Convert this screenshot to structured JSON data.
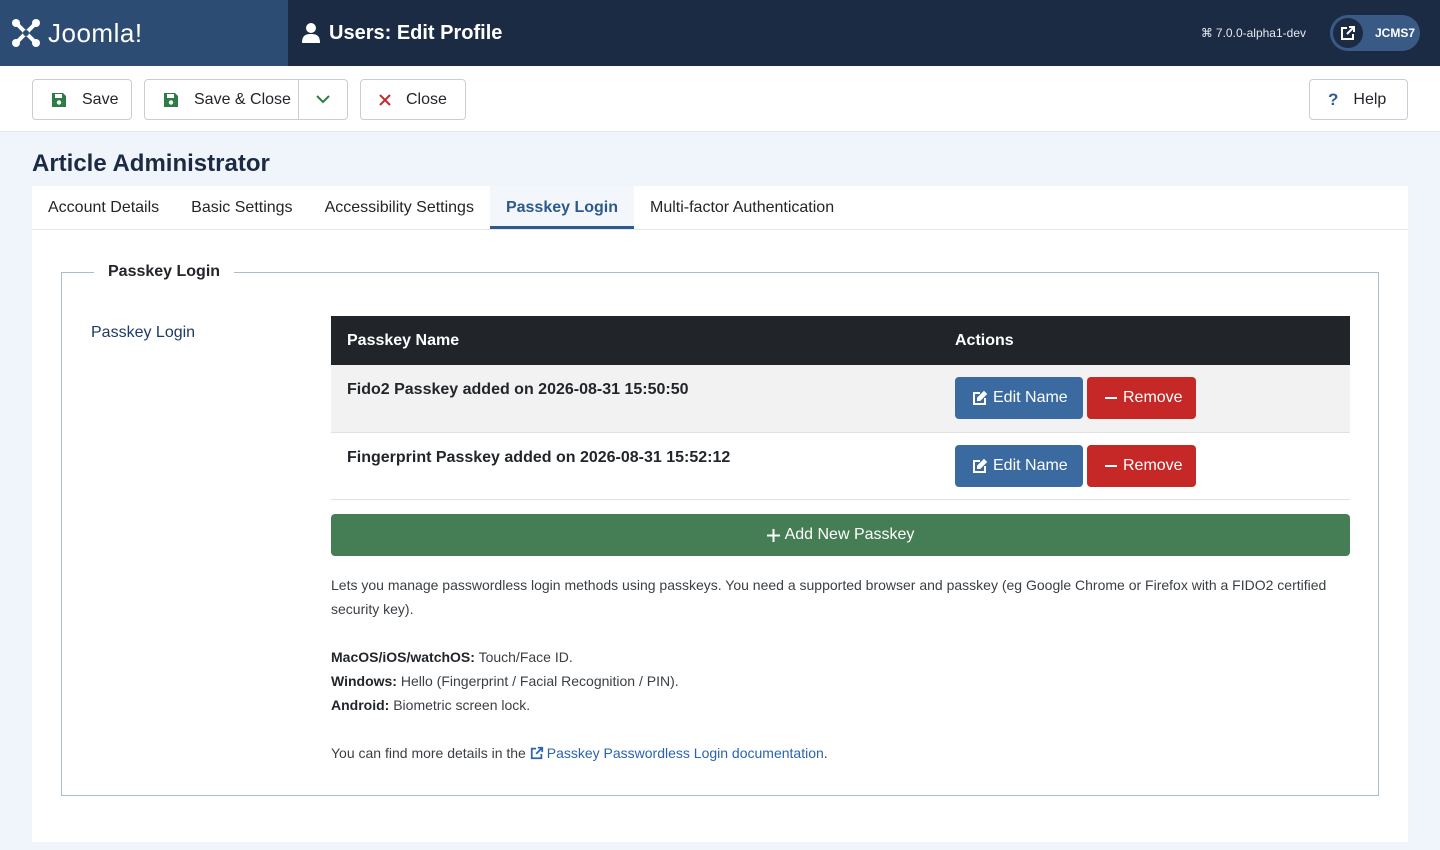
{
  "header": {
    "logo_text": "Joomla!",
    "title": "Users: Edit Profile",
    "version": "7.0.0-alpha1-dev",
    "site_button": "JCMS7"
  },
  "toolbar": {
    "save": "Save",
    "save_close": "Save & Close",
    "close": "Close",
    "help": "Help"
  },
  "section_title": "Article Administrator",
  "tabs": [
    {
      "label": "Account Details"
    },
    {
      "label": "Basic Settings"
    },
    {
      "label": "Accessibility Settings"
    },
    {
      "label": "Passkey Login"
    },
    {
      "label": "Multi-factor Authentication"
    }
  ],
  "passkey": {
    "legend": "Passkey Login",
    "side_label": "Passkey Login",
    "table": {
      "col_name": "Passkey Name",
      "col_actions": "Actions",
      "rows": [
        {
          "name": "Fido2 Passkey added on 2026-08-31 15:50:50",
          "edit": "Edit Name",
          "remove": "Remove"
        },
        {
          "name": "Fingerprint Passkey added on 2026-08-31 15:52:12",
          "edit": "Edit Name",
          "remove": "Remove"
        }
      ]
    },
    "add_button": "Add New Passkey",
    "description": "Lets you manage passwordless login methods using passkeys. You need a supported browser and passkey (eg Google Chrome or Firefox with a FIDO2 certified security key).",
    "platforms": [
      {
        "name": "MacOS/iOS/watchOS:",
        "value": "Touch/Face ID."
      },
      {
        "name": "Windows:",
        "value": "Hello (Fingerprint / Facial Recognition / PIN)."
      },
      {
        "name": "Android:",
        "value": "Biometric screen lock."
      }
    ],
    "more_prefix": "You can find more details in the",
    "doc_link": "Passkey Passwordless Login documentation",
    "more_suffix": "."
  },
  "colors": {
    "header_bg": "#1c2b44",
    "logo_bg": "#2d4c74",
    "primary": "#3a6aa0",
    "danger": "#c52827",
    "success": "#457d54"
  }
}
